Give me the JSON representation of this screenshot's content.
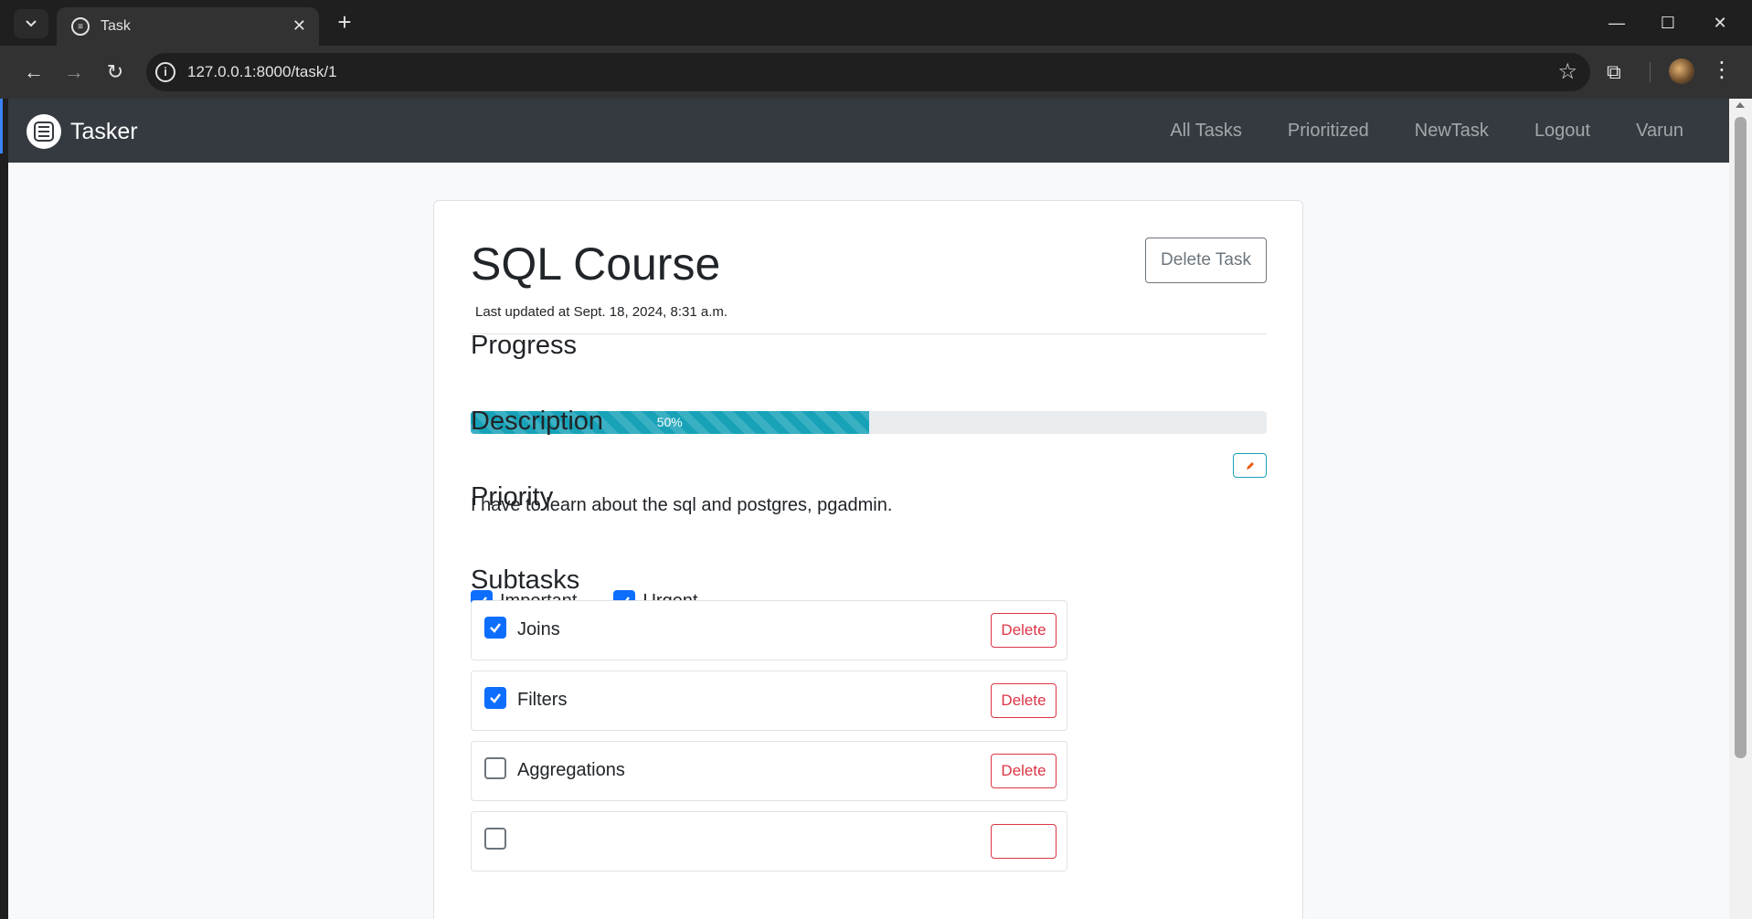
{
  "browser": {
    "tab_title": "Task",
    "url": "127.0.0.1:8000/task/1"
  },
  "navbar": {
    "brand": "Tasker",
    "links": [
      "All Tasks",
      "Prioritized",
      "NewTask",
      "Logout",
      "Varun"
    ]
  },
  "task": {
    "title": "SQL Course",
    "updated": "Last updated at Sept. 18, 2024, 8:31 a.m.",
    "delete_label": "Delete Task",
    "progress_heading": "Progress",
    "progress_value": 0.5,
    "progress_label": "50%",
    "description_heading": "Description",
    "description": "I have to learn about the sql and postgres, pgadmin.",
    "priority_heading": "Priority",
    "priority": [
      {
        "label": "Important",
        "checked": true
      },
      {
        "label": "Urgent",
        "checked": true
      }
    ],
    "subtasks_heading": "Subtasks",
    "subtasks": [
      {
        "label": "Joins",
        "checked": true,
        "delete_label": "Delete"
      },
      {
        "label": "Filters",
        "checked": true,
        "delete_label": "Delete"
      },
      {
        "label": "Aggregations",
        "checked": false,
        "delete_label": "Delete"
      },
      {
        "label": "",
        "checked": false,
        "delete_label": ""
      }
    ]
  },
  "colors": {
    "navbar_bg": "#343a40",
    "progress_fill": "#17a2b8",
    "checkbox_on": "#0d6efd",
    "danger": "#dc3545",
    "secondary": "#6c757d"
  },
  "icons": {
    "edit": "pencil-icon",
    "checkbox_checked": "checkmark-icon"
  }
}
